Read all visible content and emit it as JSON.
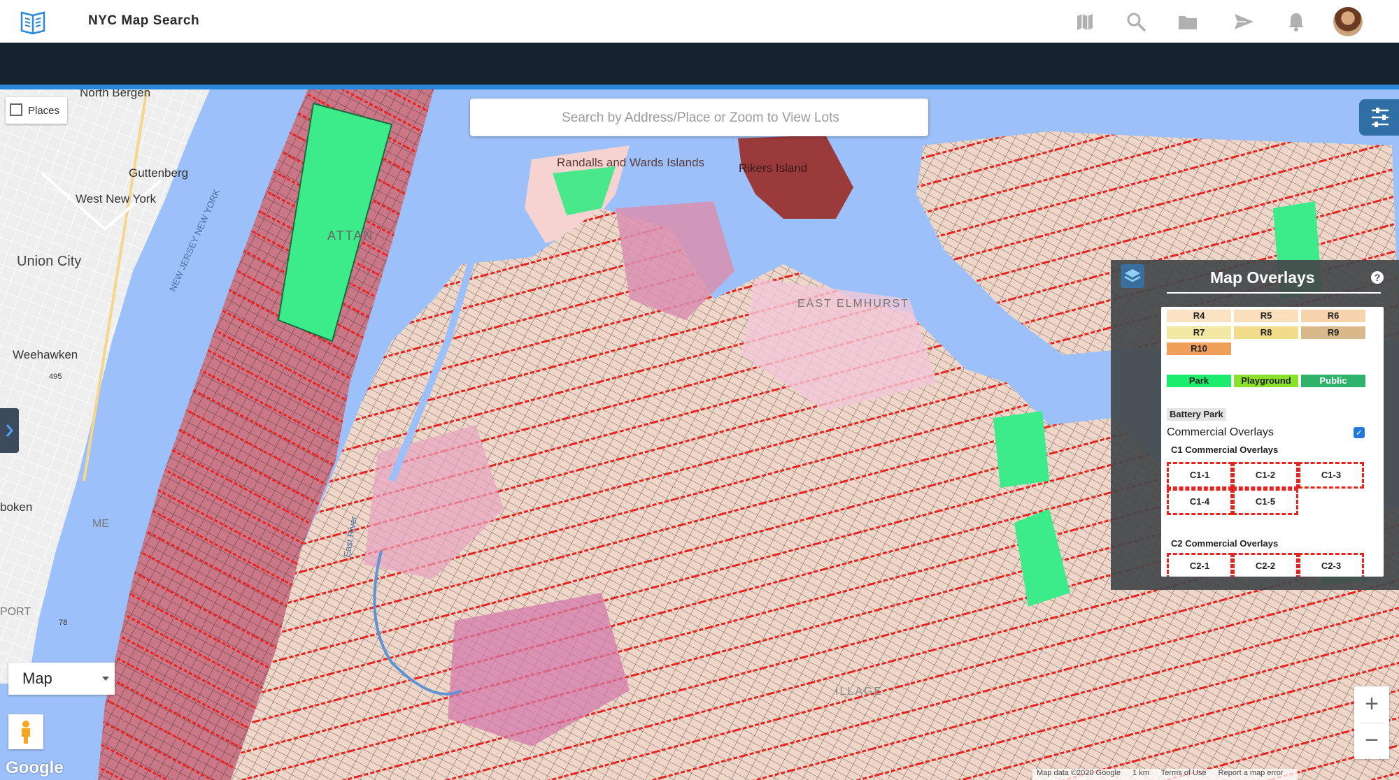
{
  "app": {
    "title": "NYC Map Search"
  },
  "header_icons": [
    "map-icon",
    "search-icon",
    "folder-icon",
    "send-icon",
    "bell-icon"
  ],
  "search": {
    "placeholder": "Search by Address/Place or Zoom to View Lots"
  },
  "places_toggle": {
    "label": "Places",
    "checked": false
  },
  "map_type": {
    "selected": "Map"
  },
  "map_labels": [
    "North Bergen",
    "Guttenberg",
    "West New York",
    "Union City",
    "Weehawken",
    "boken",
    "Randalls and Wards Islands",
    "Rikers Island",
    "EAST ELMHURST",
    "ATTAN",
    "NEW JERSEY NEW YORK",
    "East River",
    "ME",
    "PORT",
    "ILLAGE",
    "495",
    "78"
  ],
  "attribution": {
    "map_data": "Map data ©2020 Google",
    "scale": "1 km",
    "terms": "Terms of Use",
    "report": "Report a map error"
  },
  "google_logo": "Google",
  "zoom": {
    "in": "+",
    "out": "−"
  },
  "overlays": {
    "title": "Map Overlays",
    "help": "?",
    "residential": [
      {
        "label": "R4",
        "color": "#fbe3c4"
      },
      {
        "label": "R5",
        "color": "#fbe0bb"
      },
      {
        "label": "R6",
        "color": "#f7d4ad"
      },
      {
        "label": "R7",
        "color": "#f3e7a4"
      },
      {
        "label": "R8",
        "color": "#f1dc8b"
      },
      {
        "label": "R9",
        "color": "#d9b98a"
      },
      {
        "label": "R10",
        "color": "#f1a05c"
      }
    ],
    "parks": {
      "park": "Park",
      "playground": "Playground",
      "public": "Public"
    },
    "battery_park": "Battery Park",
    "commercial_overlays": {
      "label": "Commercial Overlays",
      "checked": true
    },
    "c1_heading": "C1 Commercial Overlays",
    "c1": [
      "C1-1",
      "C1-2",
      "C1-3",
      "C1-4",
      "C1-5"
    ],
    "c2_heading": "C2 Commercial Overlays",
    "c2": [
      "C2-1",
      "C2-2",
      "C2-3"
    ]
  },
  "colors": {
    "header_dark": "#16222e",
    "accent_blue": "#2b87d8",
    "water": "#9cc0f9",
    "overlay_red": "#e8231f"
  }
}
